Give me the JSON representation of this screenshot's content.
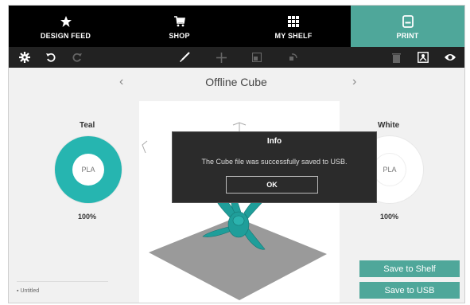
{
  "nav": {
    "items": [
      {
        "label": "DESIGN FEED",
        "icon": "star-icon"
      },
      {
        "label": "SHOP",
        "icon": "cart-icon"
      },
      {
        "label": "MY SHELF",
        "icon": "grid-icon"
      },
      {
        "label": "PRINT",
        "icon": "printer-icon",
        "active": true
      }
    ]
  },
  "toolbar": {
    "icons": [
      "gear-icon",
      "undo-icon",
      "redo-icon",
      "brush-icon",
      "move-icon",
      "scale-icon",
      "rotate-icon",
      "trash-icon",
      "support-icon",
      "eye-icon"
    ]
  },
  "main": {
    "title": "Offline Cube",
    "left_material": {
      "name": "Teal",
      "type": "PLA",
      "percent": "100%",
      "color": "#26b5b0"
    },
    "right_material": {
      "name": "White",
      "type": "PLA",
      "percent": "100%",
      "color": "#ffffff"
    },
    "untitled": "Untitled"
  },
  "dialog": {
    "title": "Info",
    "message": "The Cube file was successfully saved to USB.",
    "ok": "OK"
  },
  "buttons": {
    "save_shelf": "Save to Shelf",
    "save_usb": "Save to USB"
  },
  "colors": {
    "accent": "#4fa79a",
    "model": "#1f9e9a",
    "platform": "#9a9a9a"
  }
}
